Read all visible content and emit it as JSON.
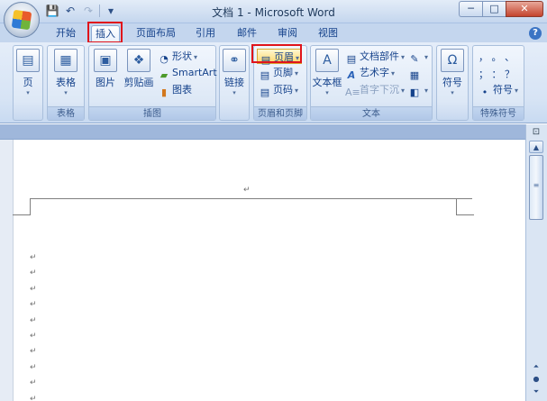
{
  "window": {
    "title": "文档 1 - Microsoft Word",
    "controls": {
      "minimize": "─",
      "maximize": "□",
      "close": "✕"
    }
  },
  "quick_access": {
    "save_icon": "save-icon",
    "undo_glyph": "↶",
    "redo_glyph": "↷",
    "dropdown_glyph": "▾"
  },
  "tabs": [
    {
      "label": "开始"
    },
    {
      "label": "插入",
      "active": true
    },
    {
      "label": "页面布局"
    },
    {
      "label": "引用"
    },
    {
      "label": "邮件"
    },
    {
      "label": "审阅"
    },
    {
      "label": "视图"
    }
  ],
  "help": {
    "glyph": "?"
  },
  "ribbon": {
    "groups": {
      "pages": {
        "label": "",
        "button": "页"
      },
      "table": {
        "label": "表格",
        "button": "表格"
      },
      "illustrations": {
        "label": "插图",
        "picture": "图片",
        "clipart": "剪贴画",
        "shapes": "形状",
        "smartart": "SmartArt",
        "chart": "图表"
      },
      "links": {
        "label": "",
        "button": "链接"
      },
      "header_footer": {
        "label": "页眉和页脚",
        "header": "页眉",
        "footer": "页脚",
        "page_number": "页码"
      },
      "text": {
        "label": "文本",
        "textbox": "文本框",
        "quickparts": "文档部件",
        "wordart": "艺术字",
        "dropcap": "首字下沉"
      },
      "symbols": {
        "label": "",
        "button": "符号",
        "glyph": "Ω"
      },
      "special": {
        "label": "特殊符号",
        "row1": "，  。  、",
        "row2": "；  ：  ？",
        "row3": "符号"
      }
    }
  },
  "document": {
    "paragraph_mark": "↵",
    "empty_paragraph_count": 10
  },
  "colors": {
    "ribbon_text": "#15428b",
    "highlight_box": "#e0141b",
    "titlebar": "#c4d6ee"
  }
}
